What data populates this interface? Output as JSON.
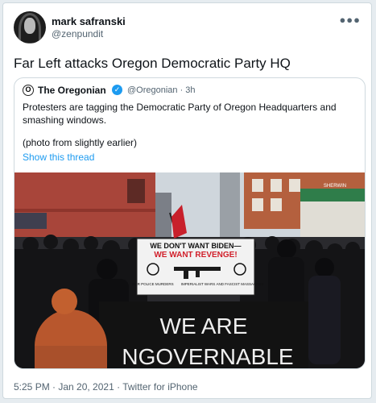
{
  "author": {
    "name": "mark safranski",
    "handle": "@zenpundit"
  },
  "tweet": {
    "text": "Far Left attacks Oregon Democratic Party HQ",
    "more_icon": "more-options-icon"
  },
  "quoted": {
    "name": "The Oregonian",
    "handle_time": "@Oregonian · 3h",
    "text": "Protesters are tagging the Democratic Party of Oregon Headquarters and smashing windows.",
    "note": "(photo from slightly earlier)",
    "show_thread": "Show this thread"
  },
  "photo": {
    "sign_top_line1": "WE DON'T WANT BIDEN—",
    "sign_top_line2": "WE WANT REVENGE!",
    "sign_left": "FOR POLICE MURDERS",
    "sign_mid": "IMPERIALIST WARS",
    "sign_right": "AND FASCIST MASSACRES",
    "banner_line1": "WE ARE",
    "banner_line2": "NGOVERNABLE",
    "store_sign": "SHERWIN"
  },
  "footer": {
    "timestamp": "5:25 PM · Jan 20, 2021 · Twitter for iPhone"
  }
}
